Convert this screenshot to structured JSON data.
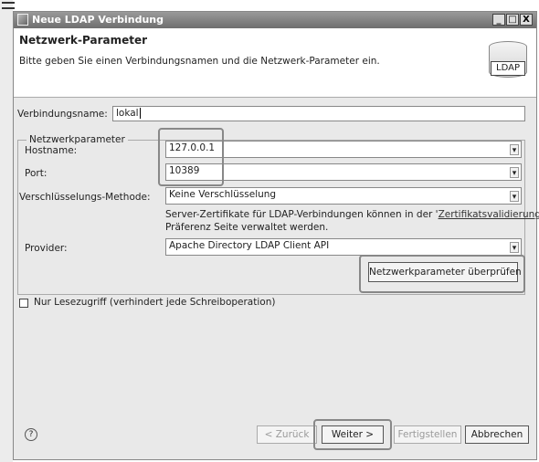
{
  "window": {
    "title": "Neue LDAP Verbindung",
    "buttons": {
      "minimize": "_",
      "maximize": "□",
      "close": "X"
    }
  },
  "header": {
    "title": "Netzwerk-Parameter",
    "description": "Bitte geben Sie einen Verbindungsnamen und die Netzwerk-Parameter ein.",
    "logo_text": "LDAP"
  },
  "connection_name": {
    "label": "Verbindungsname:",
    "value": "lokal"
  },
  "network": {
    "group_label": "Netzwerkparameter",
    "hostname": {
      "label": "Hostname:",
      "value": "127.0.0.1"
    },
    "port": {
      "label": "Port:",
      "value": "10389"
    },
    "encryption": {
      "label": "Verschlüsselungs-Methode:",
      "value": "Keine Verschlüsselung"
    },
    "hint_line1_before": "Server-Zertifikate für LDAP-Verbindungen können in der '",
    "hint_link": "Zertifikatsvalidierung",
    "hint_line1_after": "'",
    "hint_line2": "Präferenz Seite verwaltet werden.",
    "provider": {
      "label": "Provider:",
      "value": "Apache Directory LDAP Client API"
    },
    "check_button": "Netzwerkparameter überprüfen"
  },
  "readonly": {
    "label": "Nur Lesezugriff (verhindert jede Schreiboperation)",
    "checked": false
  },
  "footer": {
    "help": "?",
    "back": "< Zurück",
    "next": "Weiter >",
    "finish": "Fertigstellen",
    "cancel": "Abbrechen"
  },
  "colors": {
    "window_bg": "#e9e9e9",
    "highlight": "#888888"
  }
}
